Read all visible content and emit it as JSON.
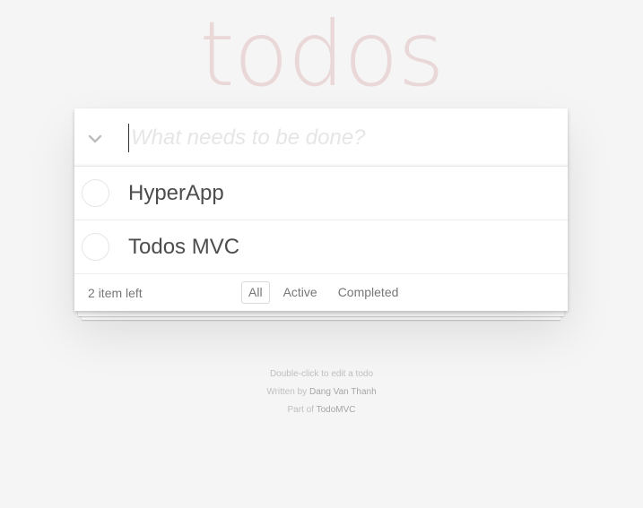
{
  "app": {
    "title": "todos"
  },
  "new_todo": {
    "placeholder": "What needs to be done?",
    "value": ""
  },
  "toggle_all": {
    "icon": "chevron-down-icon"
  },
  "todos": [
    {
      "label": "HyperApp",
      "completed": false
    },
    {
      "label": "Todos MVC",
      "completed": false
    }
  ],
  "footer": {
    "count_number": "2",
    "count_suffix": "item left",
    "filters": [
      {
        "label": "All",
        "selected": true
      },
      {
        "label": "Active",
        "selected": false
      },
      {
        "label": "Completed",
        "selected": false
      }
    ]
  },
  "info": {
    "line1": "Double-click to edit a todo",
    "line2_prefix": "Written by",
    "line2_author": "Dang Van Thanh",
    "line3_prefix": "Part of",
    "line3_link": "TodoMVC"
  },
  "colors": {
    "background": "#f5f5f5",
    "title": "#e6d4d4",
    "text": "#4d4d4d",
    "muted": "#777777",
    "border": "#e6e6e6"
  }
}
